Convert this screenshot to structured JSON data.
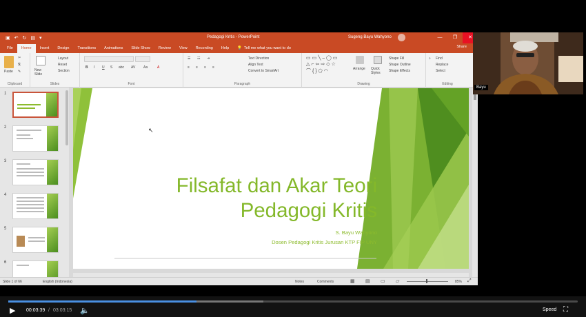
{
  "window": {
    "doc_title": "Pedagogi Kritis - PowerPoint",
    "account": "Sugeng Bayu Wahyono",
    "controls": [
      "—",
      "❐",
      "✕"
    ]
  },
  "tabs": [
    "File",
    "Home",
    "Insert",
    "Design",
    "Transitions",
    "Animations",
    "Slide Show",
    "Review",
    "View",
    "Recording",
    "Help"
  ],
  "tell_me": "Tell me what you want to do",
  "share": "Share",
  "ribbon": {
    "clipboard": {
      "paste": "Paste",
      "label": "Clipboard"
    },
    "slides": {
      "new_slide": "New Slide",
      "layout": "Layout",
      "reset": "Reset",
      "section": "Section",
      "label": "Slides"
    },
    "font": {
      "label": "Font"
    },
    "paragraph": {
      "text_direction": "Text Direction",
      "align_text": "Align Text",
      "smartart": "Convert to SmartArt",
      "label": "Paragraph"
    },
    "drawing": {
      "arrange": "Arrange",
      "quick_styles": "Quick Styles",
      "fill": "Shape Fill",
      "outline": "Shape Outline",
      "effects": "Shape Effects",
      "label": "Drawing"
    },
    "editing": {
      "find": "Find",
      "replace": "Replace",
      "select": "Select",
      "label": "Editing"
    }
  },
  "thumbs": [
    "1",
    "2",
    "3",
    "4",
    "5",
    "6"
  ],
  "slide": {
    "title_line1": "Filsafat dan Akar Teori",
    "title_line2": "Pedagogi Kritis",
    "author": "S. Bayu Wahyono",
    "role": "Dosen Pedagogi Kritis Jurusan KTP FIP UNY"
  },
  "status": {
    "slide_of": "Slide 1 of 66",
    "language": "English (Indonesia)",
    "notes": "Notes",
    "comments": "Comments",
    "zoom": "85%"
  },
  "webcam": {
    "name": "Bayu"
  },
  "player": {
    "current": "00:03:39",
    "separator": "/",
    "total": "03:03:15",
    "speed": "Speed",
    "played_fraction": 0.33
  }
}
